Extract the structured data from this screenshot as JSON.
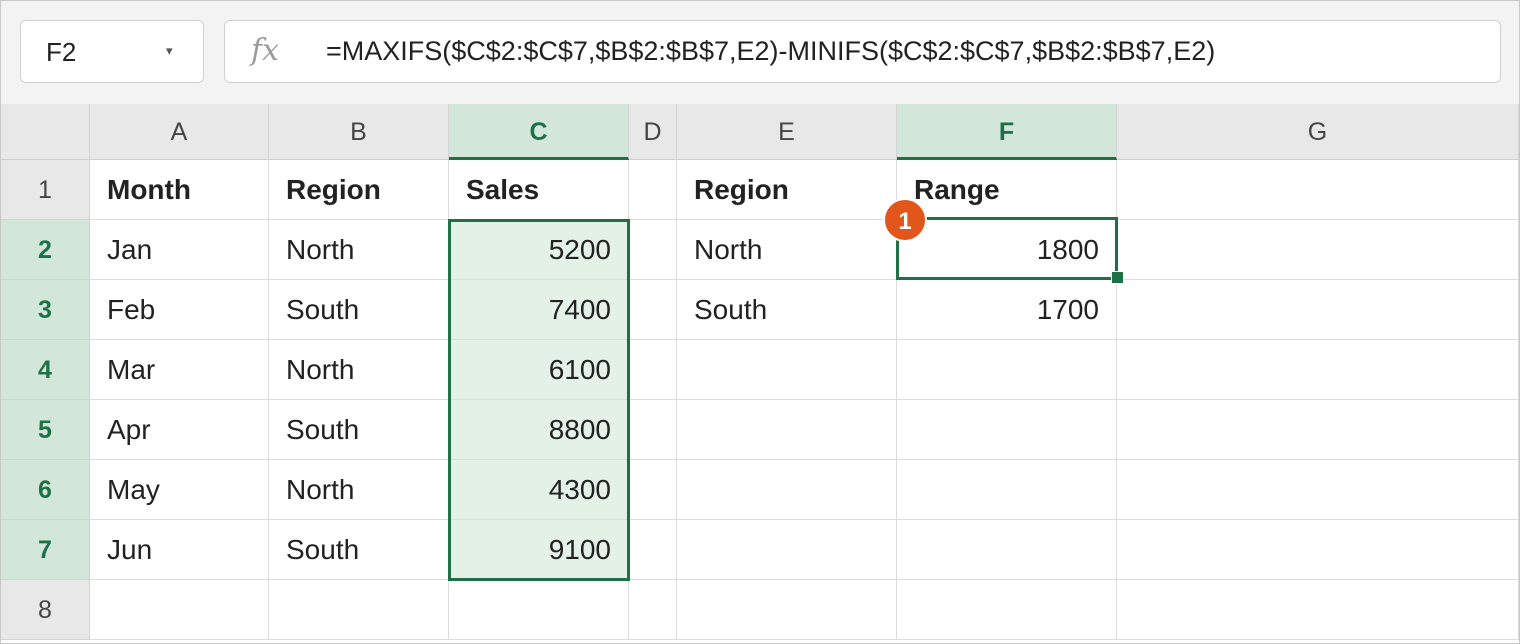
{
  "formula_bar": {
    "name_box": "F2",
    "name_box_caret": "▾",
    "fx_label": "fx",
    "formula": "=MAXIFS($C$2:$C$7,$B$2:$B$7,E2)-MINIFS($C$2:$C$7,$B$2:$B$7,E2)"
  },
  "columns": [
    "A",
    "B",
    "C",
    "D",
    "E",
    "F",
    "G"
  ],
  "selected_column": "F",
  "highlighted_column": "C",
  "rows": [
    "1",
    "2",
    "3",
    "4",
    "5",
    "6",
    "7",
    "8"
  ],
  "cells": {
    "A1": "Month",
    "B1": "Region",
    "C1": "Sales",
    "E1": "Region",
    "F1": "Range",
    "A2": "Jan",
    "B2": "North",
    "C2": "5200",
    "E2": "North",
    "F2": "1800",
    "A3": "Feb",
    "B3": "South",
    "C3": "7400",
    "E3": "South",
    "F3": "1700",
    "A4": "Mar",
    "B4": "North",
    "C4": "6100",
    "A5": "Apr",
    "B5": "South",
    "C5": "8800",
    "A6": "May",
    "B6": "North",
    "C6": "4300",
    "A7": "Jun",
    "B7": "South",
    "C7": "9100"
  },
  "active_cell": "F2",
  "callout_badge": "1",
  "colors": {
    "accent": "#1e7145",
    "badge": "#e2561b",
    "highlight_fill": "#e3f1e7",
    "header_selected": "#d2e7da"
  }
}
